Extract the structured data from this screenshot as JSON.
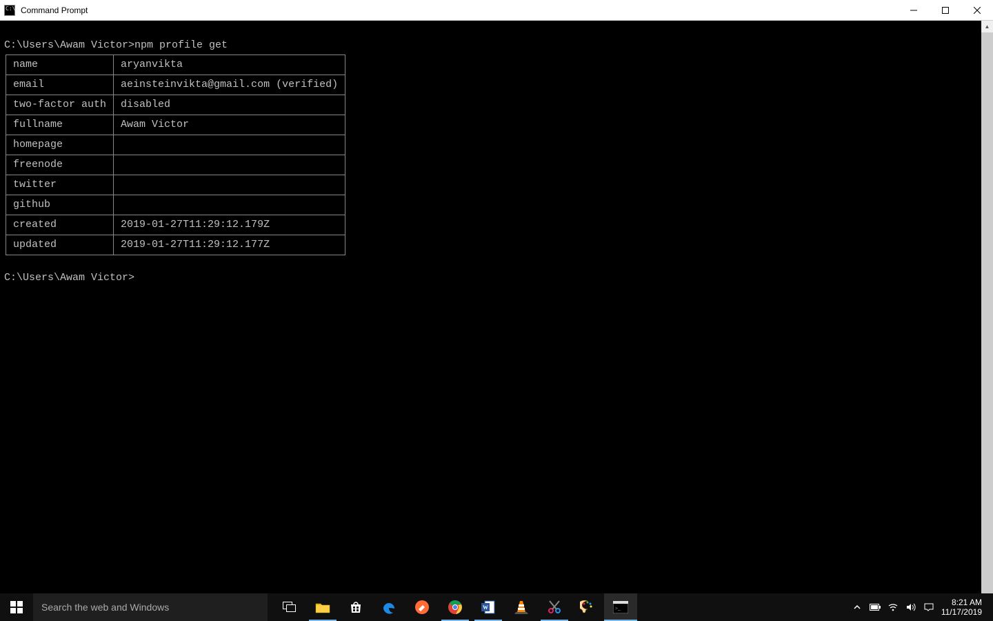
{
  "window": {
    "title": "Command Prompt"
  },
  "terminal": {
    "prompt1_path": "C:\\Users\\Awam Victor>",
    "prompt1_cmd": "npm profile get",
    "prompt2_path": "C:\\Users\\Awam Victor>",
    "table": [
      {
        "key": "name",
        "value": "aryanvikta"
      },
      {
        "key": "email",
        "value": "aeinsteinvikta@gmail.com (verified)"
      },
      {
        "key": "two-factor auth",
        "value": "disabled"
      },
      {
        "key": "fullname",
        "value": "Awam Victor"
      },
      {
        "key": "homepage",
        "value": ""
      },
      {
        "key": "freenode",
        "value": ""
      },
      {
        "key": "twitter",
        "value": ""
      },
      {
        "key": "github",
        "value": ""
      },
      {
        "key": "created",
        "value": "2019-01-27T11:29:12.179Z"
      },
      {
        "key": "updated",
        "value": "2019-01-27T11:29:12.177Z"
      }
    ]
  },
  "taskbar": {
    "search_placeholder": "Search the web and Windows",
    "clock_time": "8:21 AM",
    "clock_date": "11/17/2019"
  }
}
